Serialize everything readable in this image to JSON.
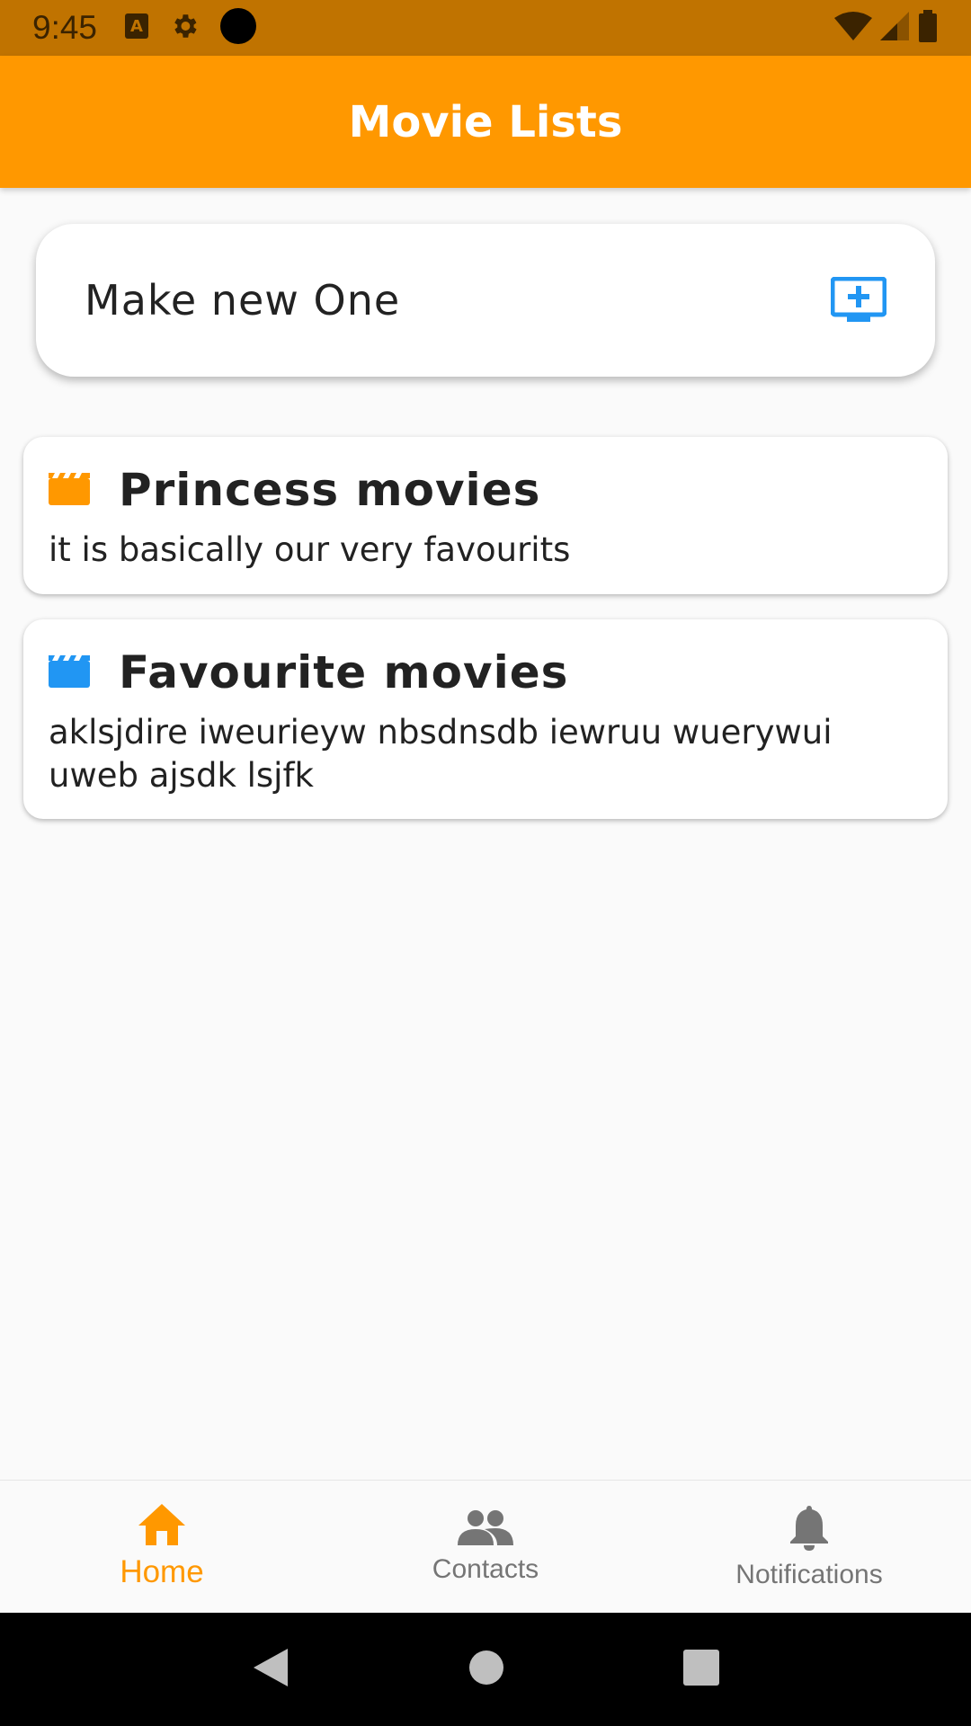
{
  "status_bar": {
    "time": "9:45",
    "left_icons": [
      "keyboard-a-icon",
      "gear-icon",
      "camera-dot-icon"
    ],
    "right_icons": [
      "wifi-icon",
      "signal-icon",
      "battery-icon"
    ]
  },
  "app_bar": {
    "title": "Movie Lists",
    "color": "#ff9800"
  },
  "new_list_card": {
    "label": "Make new One",
    "icon": "add-to-queue-icon",
    "icon_color": "#2196f3"
  },
  "movie_lists": [
    {
      "title": "Princess movies",
      "description": "it is basically our very favourits",
      "icon": "movie-clapper-icon",
      "icon_color": "#ff9800"
    },
    {
      "title": "Favourite movies",
      "description": "aklsjdire iweurieyw nbsdnsdb iewruu wuerywui uweb ajsdk lsjfk",
      "icon": "movie-clapper-icon",
      "icon_color": "#2196f3"
    }
  ],
  "bottom_nav": {
    "items": [
      {
        "label": "Home",
        "icon": "home-icon",
        "active": true
      },
      {
        "label": "Contacts",
        "icon": "people-icon",
        "active": false
      },
      {
        "label": "Notifications",
        "icon": "bell-icon",
        "active": false
      }
    ],
    "active_color": "#ff9800",
    "inactive_color": "#757575"
  },
  "system_nav": {
    "items": [
      "back-icon",
      "home-circle-icon",
      "recents-icon"
    ]
  }
}
